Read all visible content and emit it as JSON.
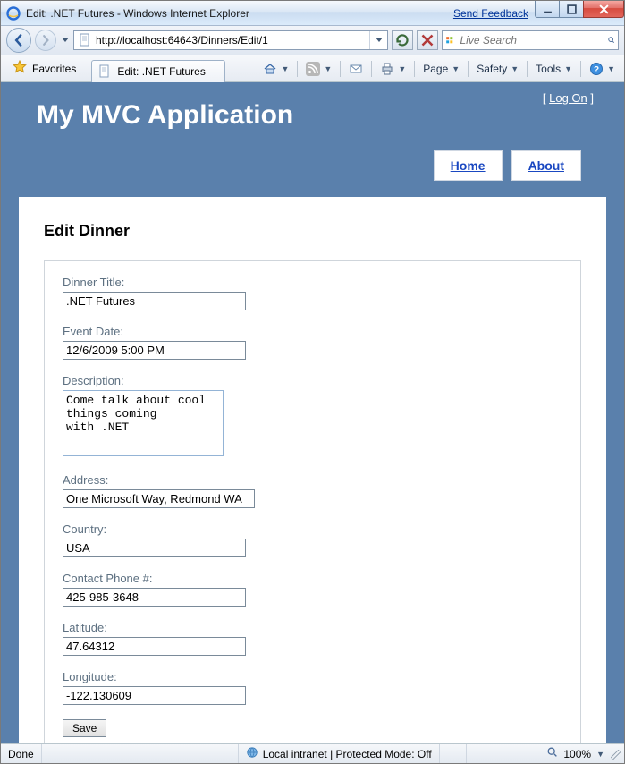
{
  "window": {
    "title": "Edit: .NET Futures - Windows Internet Explorer",
    "feedback": "Send Feedback"
  },
  "nav": {
    "url": "http://localhost:64643/Dinners/Edit/1",
    "search_placeholder": "Live Search"
  },
  "cmd": {
    "favorites": "Favorites",
    "tab_title": "Edit: .NET Futures",
    "page": "Page",
    "safety": "Safety",
    "tools": "Tools"
  },
  "site": {
    "logon_open": "[ ",
    "logon_link": "Log On",
    "logon_close": " ]",
    "app_title": "My MVC Application",
    "nav_home": "Home",
    "nav_about": "About"
  },
  "page": {
    "heading": "Edit Dinner",
    "labels": {
      "title": "Dinner Title:",
      "event_date": "Event Date:",
      "description": "Description:",
      "address": "Address:",
      "country": "Country:",
      "phone": "Contact Phone #:",
      "latitude": "Latitude:",
      "longitude": "Longitude:"
    },
    "values": {
      "title": ".NET Futures",
      "event_date": "12/6/2009 5:00 PM",
      "description": "Come talk about cool things coming\nwith .NET",
      "address": "One Microsoft Way, Redmond WA",
      "country": "USA",
      "phone": "425-985-3648",
      "latitude": "47.64312",
      "longitude": "-122.130609"
    },
    "save": "Save"
  },
  "status": {
    "done": "Done",
    "zone": "Local intranet | Protected Mode: Off",
    "zoom": "100%"
  }
}
